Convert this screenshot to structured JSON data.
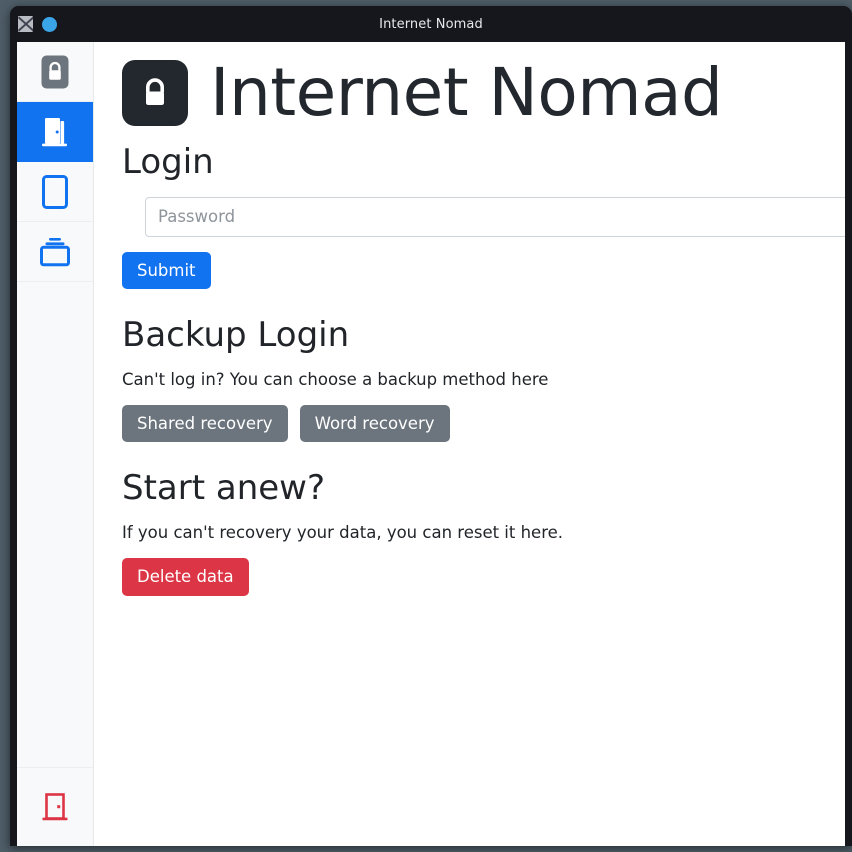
{
  "window": {
    "title": "Internet Nomad",
    "app_icon": "window-app-icon",
    "status_dot_icon": "blue-circle-icon",
    "frame_color": "#15171c",
    "desktop_color": "#4e5d68"
  },
  "sidebar": {
    "background": "#f8f9fa",
    "active_color": "#1273f0",
    "items": [
      {
        "name": "sidebar-item-vault",
        "icon": "lock-badge-icon",
        "active": false,
        "color": "#6c757d"
      },
      {
        "name": "sidebar-item-login",
        "icon": "door-icon",
        "active": true,
        "color": "#ffffff"
      },
      {
        "name": "sidebar-item-notes",
        "icon": "card-icon",
        "active": false,
        "color": "#1273f0"
      },
      {
        "name": "sidebar-item-archive",
        "icon": "archive-box-icon",
        "active": false,
        "color": "#1273f0"
      }
    ],
    "bottom_item": {
      "name": "sidebar-item-logout",
      "icon": "exit-door-icon",
      "color": "#dc3545"
    }
  },
  "brand": {
    "logo_icon": "lock-logo-icon",
    "logo_background": "#23272e",
    "title": "Internet Nomad"
  },
  "login": {
    "heading": "Login",
    "password_placeholder": "Password",
    "password_value": "",
    "submit_label": "Submit"
  },
  "backup": {
    "heading": "Backup Login",
    "description": "Can't log in? You can choose a backup method here",
    "shared_recovery_label": "Shared recovery",
    "word_recovery_label": "Word recovery"
  },
  "reset": {
    "heading": "Start anew?",
    "description": "If you can't recovery your data, you can reset it here.",
    "delete_label": "Delete data"
  }
}
